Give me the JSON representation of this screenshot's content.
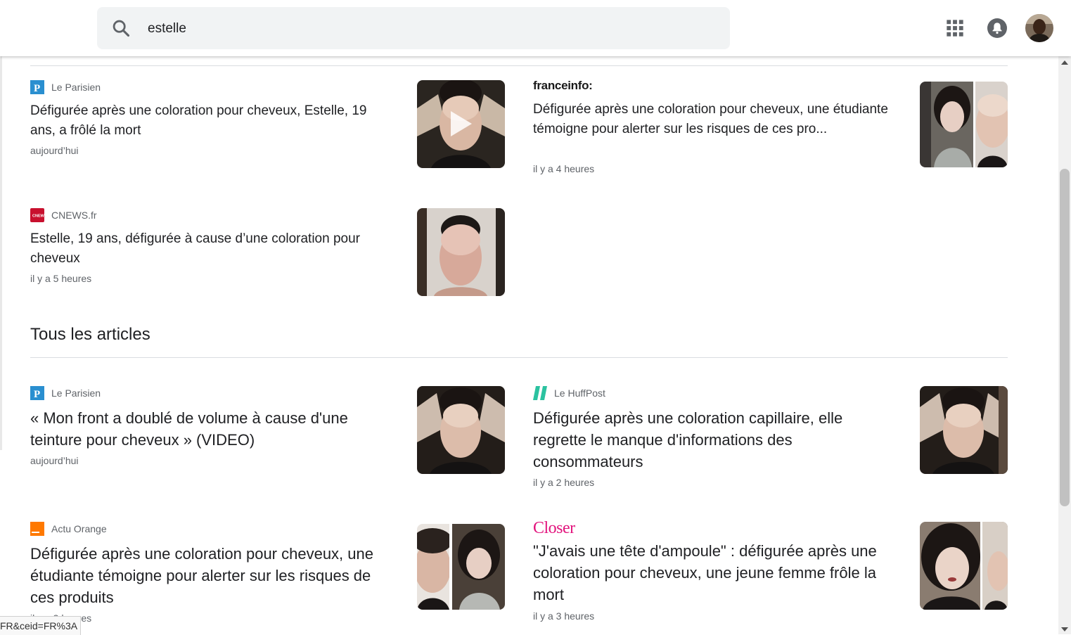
{
  "search": {
    "query": "estelle"
  },
  "header": {
    "apps_icon": "apps-grid-icon",
    "notifications_icon": "bell-icon",
    "avatar": "user-avatar"
  },
  "top_articles": [
    {
      "source": "Le Parisien",
      "title": "Défigurée après une coloration pour cheveux, Estelle, 19 ans, a frôlé la mort",
      "time": "aujourd’hui",
      "has_video": true
    },
    {
      "source": "franceinfo:",
      "title": "Défigurée après une coloration pour cheveux, une étudiante témoigne pour alerter sur les risques de ces pro...",
      "time": "il y a 4 heures"
    },
    {
      "source": "CNEWS.fr",
      "title": "Estelle, 19 ans, défigurée à cause d’une coloration pour cheveux",
      "time": "il y a 5 heures"
    }
  ],
  "section": {
    "title": "Tous les articles"
  },
  "all_articles": [
    {
      "source": "Le Parisien",
      "title": "« Mon front a doublé de volume à cause d'une teinture pour cheveux » (VIDEO)",
      "time": "aujourd’hui"
    },
    {
      "source": "Le HuffPost",
      "title": "Défigurée après une coloration capillaire, elle regrette le manque d'informations des consommateurs",
      "time": "il y a 2 heures"
    },
    {
      "source": "Actu Orange",
      "title": "Défigurée après une coloration pour cheveux, une étudiante témoigne pour alerter sur les risques de ces produits",
      "time": "il y a 3 heures"
    },
    {
      "source": "Closer",
      "title": "\"J'avais une tête d'ampoule\" : défigurée après une coloration pour cheveux, une jeune femme frôle la mort",
      "time": "il y a 3 heures"
    }
  ],
  "status_bar": {
    "url_fragment": "FR&ceid=FR%3A"
  },
  "colors": {
    "parisien_blue": "#2a8fd0",
    "cnews_red": "#c8102e",
    "huffpost_green": "#2bc2a0",
    "orange": "#ff7900",
    "closer_pink": "#e2147d",
    "franceinfo_yellow": "#f4b400"
  }
}
